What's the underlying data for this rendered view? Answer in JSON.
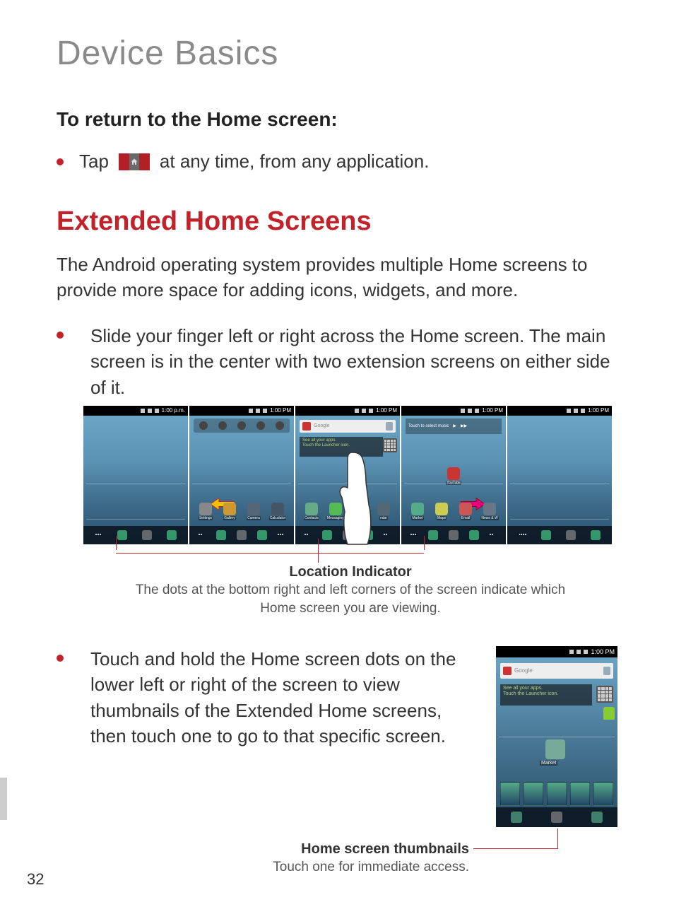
{
  "chapter_title": "Device Basics",
  "return_heading": "To return to the Home screen:",
  "tap_before": "Tap",
  "tap_after": "at any time, from any application.",
  "section_heading": "Extended Home Screens",
  "intro_body": "The Android operating system provides multiple Home screens to provide more space for adding icons, widgets, and more.",
  "bullet1": "Slide your finger left or right across the Home screen. The main screen is in the center with two extension screens on either side of it.",
  "screens": {
    "time_left": "1:00 p.m.",
    "time": "1:00 PM",
    "search_placeholder": "Google",
    "tip_line1": "See all your apps.",
    "tip_line2": "Touch the Launcher icon.",
    "music_prompt": "Touch to select music",
    "app_labels_2": [
      "Settings",
      "Gallery",
      "Camera",
      "Calculator"
    ],
    "app_labels_3": [
      "Contacts",
      "Messaging",
      "",
      "ndar"
    ],
    "app_labels_4": [
      "Market",
      "Maps",
      "Email",
      "News & W"
    ],
    "youtube": "YouTube"
  },
  "callout1_title": "Location Indicator",
  "callout1_sub": "The dots at the bottom right and left corners of the screen indicate which Home screen you are viewing.",
  "bullet2": "Touch and hold the Home screen dots on the lower left or right of the screen to view thumbnails of the Extended Home screens, then touch one to go to that specific screen.",
  "thumb": {
    "time": "1:00 PM",
    "search_placeholder": "Google",
    "tip_line1": "See all your apps.",
    "tip_line2": "Touch the Launcher icon.",
    "market": "Market"
  },
  "callout2_title": "Home screen thumbnails",
  "callout2_sub": "Touch one for immediate access.",
  "page_number": "32"
}
